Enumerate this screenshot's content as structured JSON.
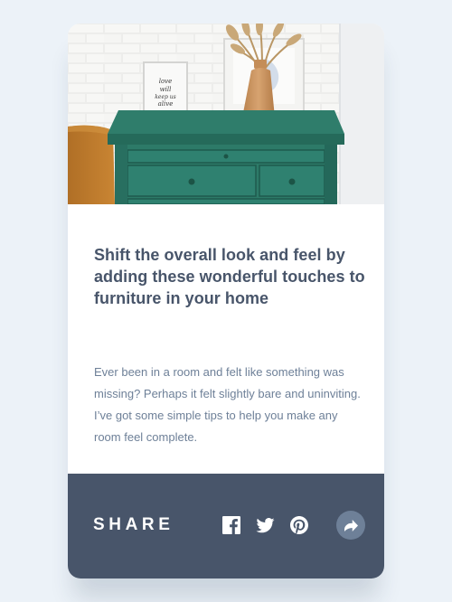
{
  "card": {
    "image_alt": "Green drawer with framed prints and a vase of dried grass",
    "title": "Shift the overall look and feel by adding these wonderful touches to furniture in your home",
    "excerpt": "Ever been in a room and felt like something was missing? Perhaps it felt slightly bare and uninviting. I’ve got some simple tips to help you make any room feel complete."
  },
  "share": {
    "label": "SHARE",
    "icons": [
      "facebook-icon",
      "twitter-icon",
      "pinterest-icon",
      "share-icon"
    ]
  },
  "colors": {
    "page_background": "#ECF2F8",
    "title_text": "#48556A",
    "body_text": "#6E8098",
    "share_bar": "#48556A",
    "share_button": "#6E8098"
  }
}
